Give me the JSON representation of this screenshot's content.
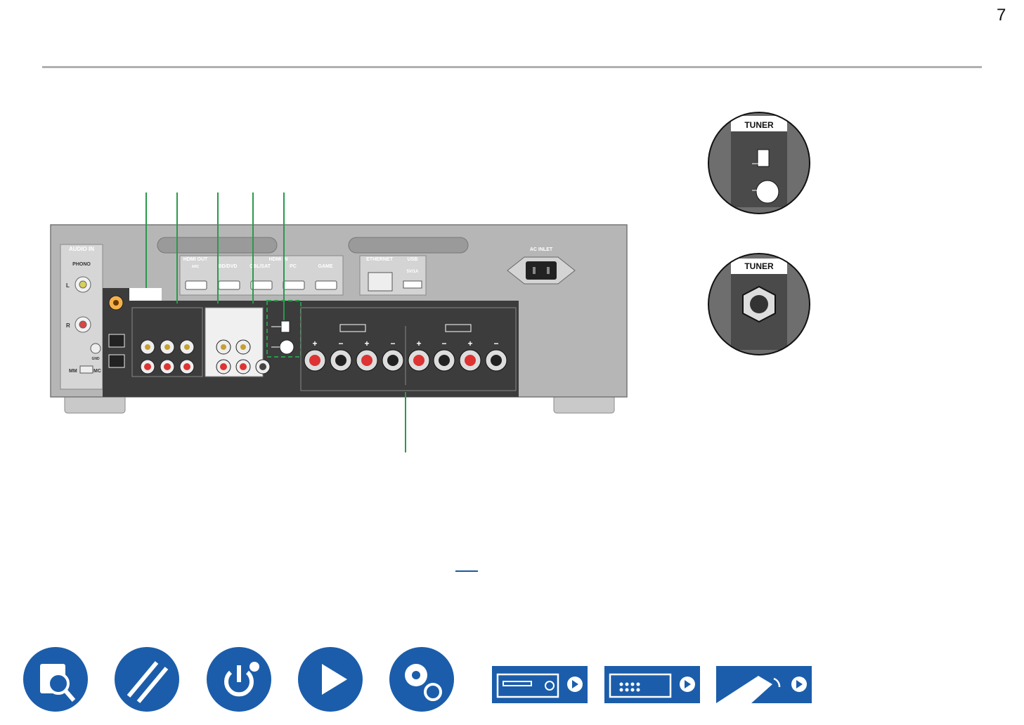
{
  "page_number": "7",
  "rear_panel": {
    "audio_in_label": "AUDIO IN",
    "phono_label": "PHONO",
    "phono_left": "L",
    "phono_right": "R",
    "gnd_label": "GND",
    "mm_label": "MM",
    "mc_label": "MC",
    "hdmi_out_label": "HDMI OUT",
    "hdmi_out_sub": "ARC",
    "hdmi_in_label": "HDMI IN",
    "hdmi_in_inputs": [
      "BD/DVD",
      "CBL/SAT",
      "PC",
      "GAME"
    ],
    "ethernet_label": "ETHERNET",
    "usb_label": "USB",
    "usb_sub": "5V/1A",
    "ac_inlet_label": "AC INLET",
    "speaker_polarity": [
      "+",
      "−",
      "+",
      "−",
      "+",
      "−",
      "+",
      "−"
    ]
  },
  "zoom_top": {
    "label": "TUNER"
  },
  "zoom_bottom": {
    "label": "TUNER"
  },
  "nav": {
    "icons": [
      "manual-search-icon",
      "cables-icon",
      "power-settings-icon",
      "play-icon",
      "gears-icon"
    ],
    "tiles": [
      "front-panel-icon",
      "rear-panel-icon",
      "remote-icon"
    ]
  },
  "colors": {
    "accent": "#1b5daa",
    "callout": "#2a9a4a",
    "panel": "#b8b8b8",
    "panel_dark": "#3c3c3c"
  }
}
